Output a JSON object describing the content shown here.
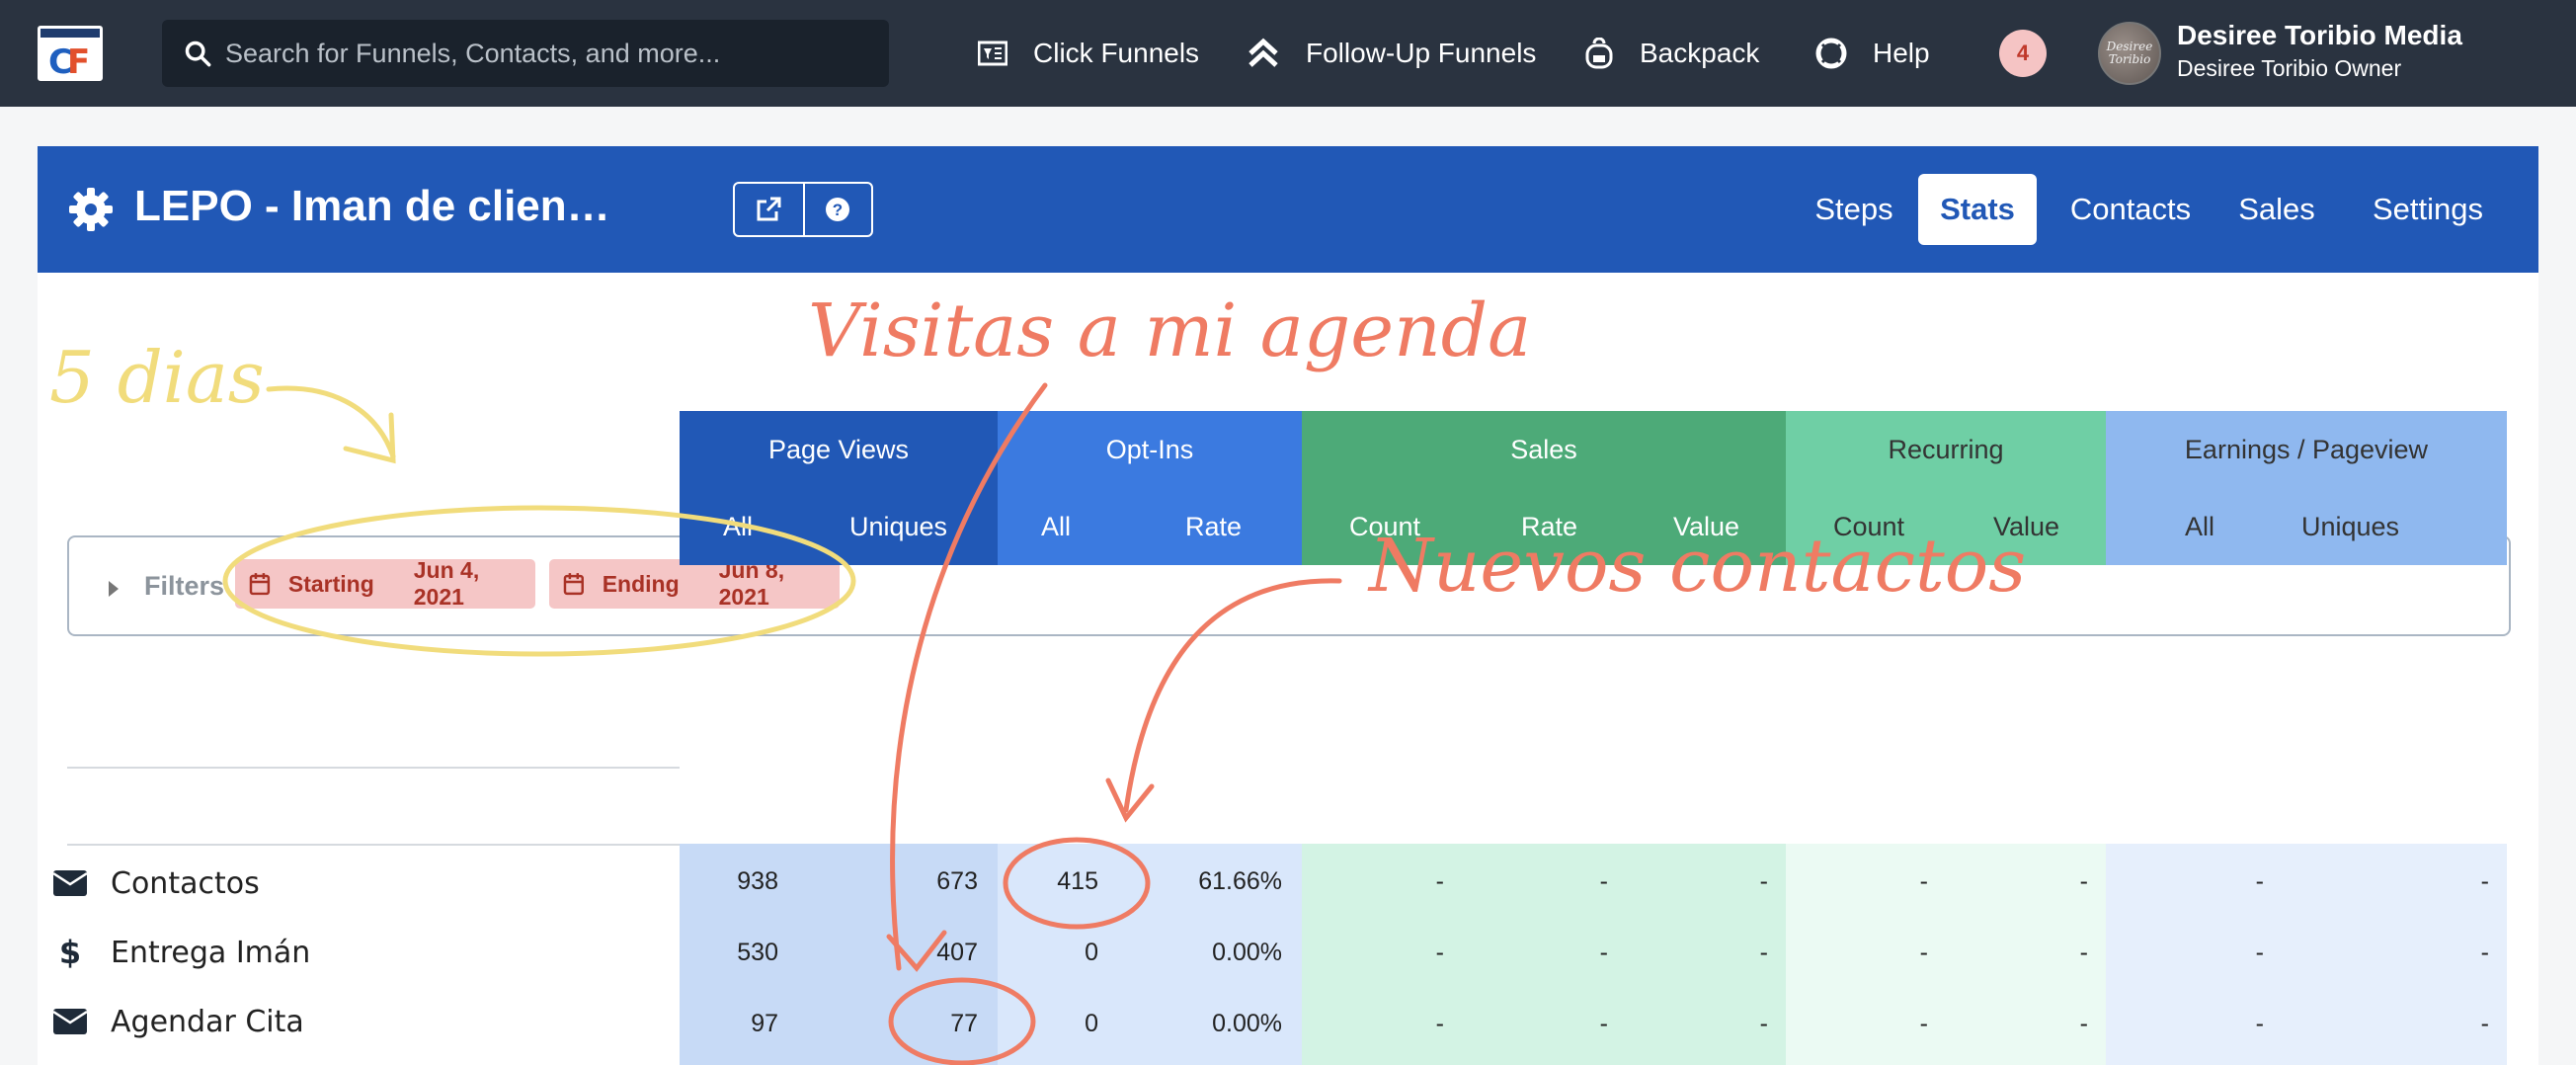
{
  "topbar": {
    "search_placeholder": "Search for Funnels, Contacts, and more...",
    "nav": [
      "Click Funnels",
      "Follow-Up Funnels",
      "Backpack",
      "Help"
    ],
    "notifications": "4",
    "avatar_text": "Desiree Toribio",
    "user_name": "Desiree Toribio Media",
    "user_role": "Desiree Toribio Owner"
  },
  "funnel": {
    "title": "LEPO - Iman de clien…",
    "tabs": [
      "Steps",
      "Stats",
      "Contacts",
      "Sales",
      "Settings"
    ],
    "active_tab": "Stats"
  },
  "filters": {
    "label": "Filters",
    "starting_label": "Starting",
    "starting_date": "Jun 4, 2021",
    "ending_label": "Ending",
    "ending_date": "Jun 8, 2021"
  },
  "table": {
    "groups": [
      "Page Views",
      "Opt-Ins",
      "Sales",
      "Recurring",
      "Earnings / Pageview"
    ],
    "subcols": [
      "All",
      "Uniques",
      "All",
      "Rate",
      "Count",
      "Rate",
      "Value",
      "Count",
      "Value",
      "All",
      "Uniques"
    ],
    "rows": [
      {
        "name": "Contactos",
        "icon": "envelope-icon",
        "values": [
          "938",
          "673",
          "415",
          "61.66%",
          "-",
          "-",
          "-",
          "-",
          "-",
          "-",
          "-"
        ]
      },
      {
        "name": "Entrega Imán",
        "icon": "dollar-icon",
        "values": [
          "530",
          "407",
          "0",
          "0.00%",
          "-",
          "-",
          "-",
          "-",
          "-",
          "-",
          "-"
        ]
      },
      {
        "name": "Agendar Cita",
        "icon": "envelope-icon",
        "values": [
          "97",
          "77",
          "0",
          "0.00%",
          "-",
          "-",
          "-",
          "-",
          "-",
          "-",
          "-"
        ]
      }
    ]
  },
  "annotations": {
    "days": "5 dias",
    "visits": "Visitas a mi agenda",
    "new_contacts": "Nuevos contactos"
  },
  "colors": {
    "topbar": "#2a3340",
    "header": "#2158b6",
    "page_views": "#2158b6",
    "opt_ins": "#3b7ae0",
    "sales": "#4daa78",
    "recurring": "#6fcfa5",
    "earnings": "#8fb8ef",
    "annotation_orange": "#ef7b63",
    "annotation_yellow": "#f1dc7c"
  }
}
